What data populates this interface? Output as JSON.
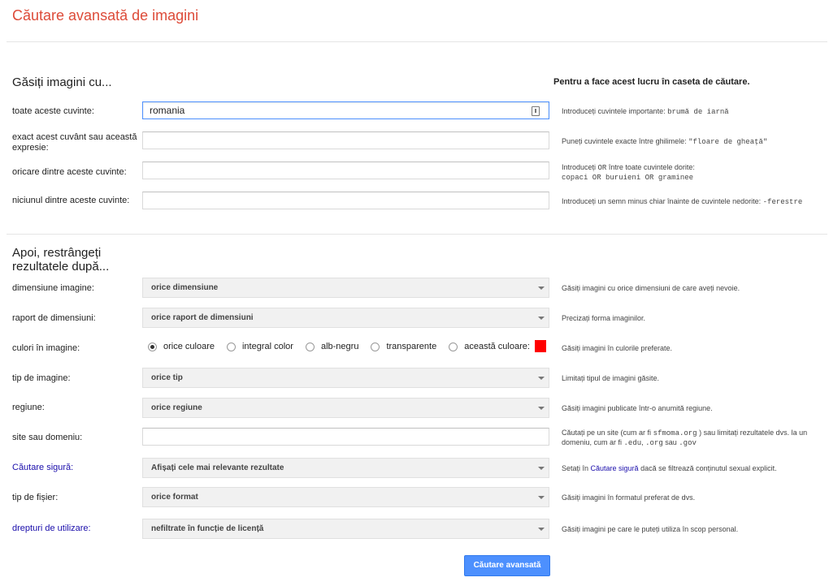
{
  "page": {
    "title": "Căutare avansată de imagini"
  },
  "find_section": {
    "heading": "Găsiți imagini cu...",
    "side_heading": "Pentru a face acest lucru în caseta de căutare.",
    "fields": [
      {
        "label": "toate aceste cuvinte:",
        "value": "romania",
        "hint_prefix": "Introduceți cuvintele importante: ",
        "hint_code": "brumă de iarnă"
      },
      {
        "label": "exact acest cuvânt sau această expresie:",
        "value": "",
        "hint_prefix": "Puneți cuvintele exacte între ghilimele: ",
        "hint_code": "\"floare de gheață\""
      },
      {
        "label": "oricare dintre aceste cuvinte:",
        "value": "",
        "hint_line1_a": "Introduceți ",
        "hint_line1_code": "OR",
        "hint_line1_b": " între toate cuvintele dorite:",
        "hint_line2_code": "copaci OR buruieni OR graminee"
      },
      {
        "label": "niciunul dintre aceste cuvinte:",
        "value": "",
        "hint_prefix": "Introduceți un semn minus chiar înainte de cuvintele nedorite: ",
        "hint_code": "-ferestre"
      }
    ]
  },
  "narrow_section": {
    "heading_line1": "Apoi, restrângeți",
    "heading_line2": "rezultatele după...",
    "image_size": {
      "label": "dimensiune imagine:",
      "value": "orice dimensiune",
      "hint": "Găsiți imagini cu orice dimensiuni de care aveți nevoie."
    },
    "aspect_ratio": {
      "label": "raport de dimensiuni:",
      "value": "orice raport de dimensiuni",
      "hint": "Precizați forma imaginilor."
    },
    "colors": {
      "label": "culori în imagine:",
      "options": [
        "orice culoare",
        "integral color",
        "alb-negru",
        "transparente",
        "această culoare:"
      ],
      "selected_index": 0,
      "swatch_color": "#ff0000",
      "hint": "Găsiți imagini în culorile preferate."
    },
    "image_type": {
      "label": "tip de imagine:",
      "value": "orice tip",
      "hint": "Limitați tipul de imagini găsite."
    },
    "region": {
      "label": "regiune:",
      "value": "orice regiune",
      "hint": "Găsiți imagini publicate într-o anumită regiune."
    },
    "site": {
      "label": "site sau domeniu:",
      "value": "",
      "hint_a": "Căutați pe un site (cum ar fi ",
      "hint_code1": "sfmoma.org",
      "hint_b": " ) sau limitați rezultatele dvs. la un domeniu, cum ar fi ",
      "hint_code2": ".edu",
      "hint_c": ", ",
      "hint_code3": ".org",
      "hint_d": " sau ",
      "hint_code4": ".gov"
    },
    "safe_search": {
      "label": "Căutare sigură:",
      "value": "Afișați cele mai relevante rezultate",
      "hint_a": "Setați în ",
      "hint_link": "Căutare sigură",
      "hint_b": " dacă se filtrează conținutul sexual explicit."
    },
    "file_type": {
      "label": "tip de fișier:",
      "value": "orice format",
      "hint": "Găsiți imagini în formatul preferat de dvs."
    },
    "usage_rights": {
      "label": "drepturi de utilizare:",
      "value": "nefiltrate în funcție de licență",
      "hint": "Găsiți imagini pe care le puteți utiliza în scop personal."
    }
  },
  "submit_label": "Căutare avansată",
  "colors": {
    "title": "#dd4b39",
    "link": "#1a0dab",
    "button": "#4d90fe"
  }
}
